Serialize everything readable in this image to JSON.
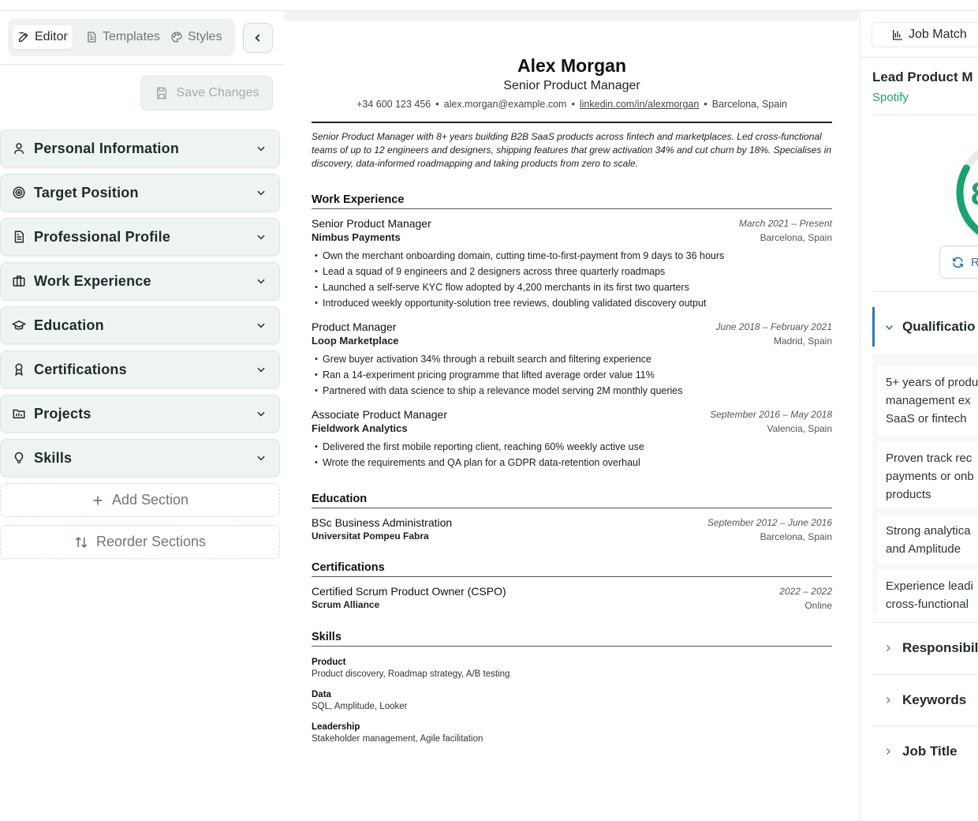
{
  "editor_tabs": [
    {
      "label": "Editor",
      "icon": "edit-icon",
      "active": true
    },
    {
      "label": "Templates",
      "icon": "document-icon",
      "active": false
    },
    {
      "label": "Styles",
      "icon": "palette-icon",
      "active": false
    }
  ],
  "save_label": "Save Changes",
  "sections": [
    {
      "label": "Personal Information",
      "icon": "user-icon"
    },
    {
      "label": "Target Position",
      "icon": "target-icon"
    },
    {
      "label": "Professional Profile",
      "icon": "file-text-icon"
    },
    {
      "label": "Work Experience",
      "icon": "briefcase-icon"
    },
    {
      "label": "Education",
      "icon": "graduation-cap-icon"
    },
    {
      "label": "Certifications",
      "icon": "award-icon"
    },
    {
      "label": "Projects",
      "icon": "project-icon"
    },
    {
      "label": "Skills",
      "icon": "lightbulb-icon"
    }
  ],
  "add_section_label": "Add Section",
  "reorder_sections_label": "Reorder Sections",
  "resume": {
    "name": "Alex Morgan",
    "title": "Senior Product Manager",
    "contact": {
      "phone": "+34 600 123 456",
      "email": "alex.morgan@example.com",
      "linkedin": "linkedin.com/in/alexmorgan",
      "location": "Barcelona, Spain"
    },
    "summary": "Senior Product Manager with 8+ years building B2B SaaS products across fintech and marketplaces. Led cross-functional teams of up to 12 engineers and designers, shipping features that grew activation 34% and cut churn by 18%. Specialises in discovery, data-informed roadmapping and taking products from zero to scale.",
    "work_title": "Work Experience",
    "jobs": [
      {
        "role": "Senior Product Manager",
        "company": "Nimbus Payments",
        "dates": "March 2021 – Present",
        "location": "Barcelona, Spain",
        "bullets": [
          "Own the merchant onboarding domain, cutting time-to-first-payment from 9 days to 36 hours",
          "Lead a squad of 9 engineers and 2 designers across three quarterly roadmaps",
          "Launched a self-serve KYC flow adopted by 4,200 merchants in its first two quarters",
          "Introduced weekly opportunity-solution tree reviews, doubling validated discovery output"
        ]
      },
      {
        "role": "Product Manager",
        "company": "Loop Marketplace",
        "dates": "June 2018 – February 2021",
        "location": "Madrid, Spain",
        "bullets": [
          "Grew buyer activation 34% through a rebuilt search and filtering experience",
          "Ran a 14-experiment pricing programme that lifted average order value 11%",
          "Partnered with data science to ship a relevance model serving 2M monthly queries"
        ]
      },
      {
        "role": "Associate Product Manager",
        "company": "Fieldwork Analytics",
        "dates": "September 2016 – May 2018",
        "location": "Valencia, Spain",
        "bullets": [
          "Delivered the first mobile reporting client, reaching 60% weekly active use",
          "Wrote the requirements and QA plan for a GDPR data-retention overhaul"
        ]
      }
    ],
    "education_title": "Education",
    "education": {
      "degree": "BSc Business Administration",
      "school": "Universitat Pompeu Fabra",
      "dates": "September 2012 – June 2016",
      "location": "Barcelona, Spain"
    },
    "certifications_title": "Certifications",
    "certification": {
      "name": "Certified Scrum Product Owner (CSPO)",
      "issuer": "Scrum Alliance",
      "dates": "2022 – 2022",
      "location": "Online"
    },
    "skills_title": "Skills",
    "skills": [
      {
        "category": "Product",
        "items": "Product discovery, Roadmap strategy, A/B testing"
      },
      {
        "category": "Data",
        "items": "SQL, Amplitude, Looker"
      },
      {
        "category": "Leadership",
        "items": "Stakeholder management, Agile facilitation"
      }
    ]
  },
  "job_match": {
    "tab_label": "Job Match",
    "job_title": "Lead Product M",
    "company": "Spotify",
    "score_glyph": "8",
    "refresh_label": "R",
    "qualifications_label": "Qualificatio",
    "qualifications": [
      [
        "5+ years of produ",
        "management ex",
        "SaaS or fintech"
      ],
      [
        "Proven track rec",
        "payments or onb",
        "products"
      ],
      [
        "Strong analytica",
        "and Amplitude"
      ],
      [
        "Experience leadi",
        "cross-functional"
      ]
    ],
    "accordions": [
      "Responsibil",
      "Keywords",
      "Job Title"
    ]
  },
  "colors": {
    "accent_green": "#1aa36b",
    "accent_blue": "#2f78b7",
    "section_bg": "#eef4f2"
  }
}
